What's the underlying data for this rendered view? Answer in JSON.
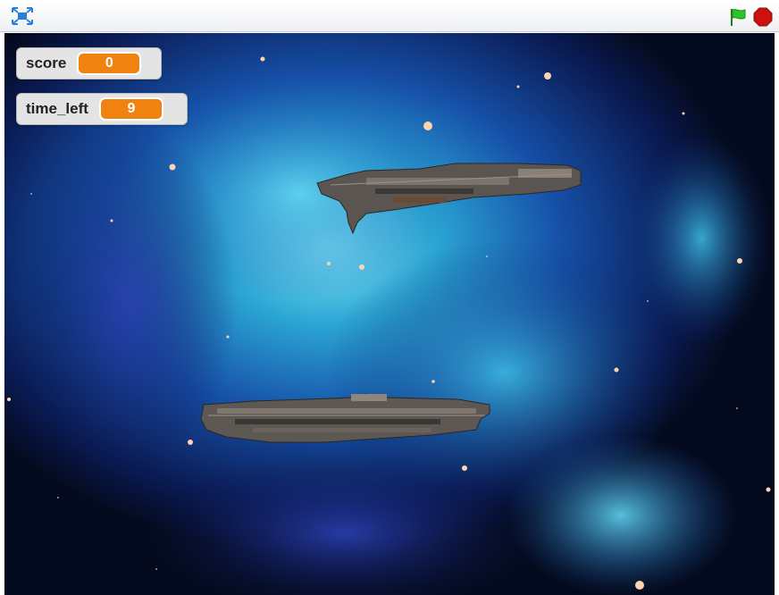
{
  "toolbar": {
    "fullscreen_icon": "fullscreen-icon",
    "green_flag_icon": "green-flag-icon",
    "stop_icon": "stop-sign-icon",
    "colors": {
      "flag": "#2fc42a",
      "stop": "#cc1111",
      "fullscreen": "#2b7fd6"
    }
  },
  "monitors": {
    "score": {
      "label": "score",
      "value": "0"
    },
    "time_left": {
      "label": "time_left",
      "value": "9"
    }
  },
  "stage": {
    "backdrop": "nebula-space",
    "sprites": [
      "spaceship-top",
      "spaceship-bottom"
    ]
  }
}
